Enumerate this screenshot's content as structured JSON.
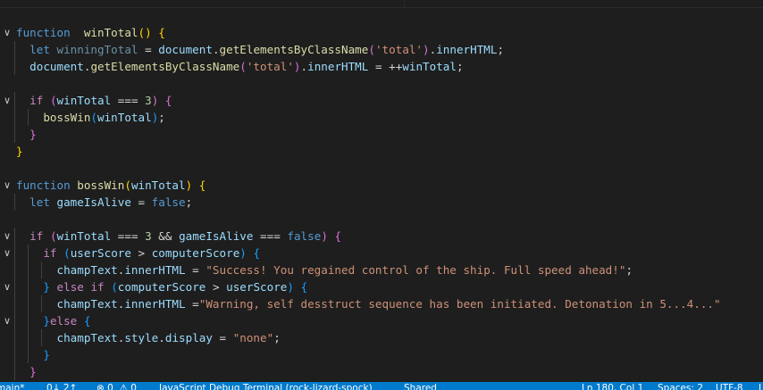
{
  "editor": {
    "lines": [
      {
        "fold": "v",
        "tokens": [
          [
            "kw",
            "function"
          ],
          [
            "",
            "  "
          ],
          [
            "fn",
            "winTotal"
          ],
          [
            "b1",
            "()"
          ],
          [
            "",
            " "
          ],
          [
            "b1",
            "{"
          ]
        ]
      },
      {
        "tokens": [
          [
            "",
            "  "
          ],
          [
            "kw",
            "let"
          ],
          [
            "",
            " "
          ],
          [
            "var unused",
            "winningTotal"
          ],
          [
            "",
            " = "
          ],
          [
            "var",
            "document"
          ],
          [
            "",
            "."
          ],
          [
            "fn",
            "getElementsByClassName"
          ],
          [
            "b2",
            "("
          ],
          [
            "str",
            "'total'"
          ],
          [
            "b2",
            ")"
          ],
          [
            "",
            "."
          ],
          [
            "var",
            "innerHTML"
          ],
          [
            "",
            ";"
          ]
        ]
      },
      {
        "tokens": [
          [
            "",
            "  "
          ],
          [
            "var",
            "document"
          ],
          [
            "",
            "."
          ],
          [
            "fn",
            "getElementsByClassName"
          ],
          [
            "b2",
            "("
          ],
          [
            "str",
            "'total'"
          ],
          [
            "b2",
            ")"
          ],
          [
            "",
            "."
          ],
          [
            "var",
            "innerHTML"
          ],
          [
            "",
            " = ++"
          ],
          [
            "var",
            "winTotal"
          ],
          [
            "",
            ";"
          ]
        ]
      },
      {
        "tokens": []
      },
      {
        "fold": "v",
        "tokens": [
          [
            "",
            "  "
          ],
          [
            "ctl",
            "if"
          ],
          [
            "",
            " "
          ],
          [
            "b2",
            "("
          ],
          [
            "var",
            "winTotal"
          ],
          [
            "",
            " === "
          ],
          [
            "num",
            "3"
          ],
          [
            "b2",
            ")"
          ],
          [
            "",
            " "
          ],
          [
            "b2",
            "{"
          ]
        ]
      },
      {
        "tokens": [
          [
            "",
            "    "
          ],
          [
            "fn",
            "bossWin"
          ],
          [
            "b3",
            "("
          ],
          [
            "var",
            "winTotal"
          ],
          [
            "b3",
            ")"
          ],
          [
            "",
            ";"
          ]
        ]
      },
      {
        "tokens": [
          [
            "",
            "  "
          ],
          [
            "b2",
            "}"
          ]
        ]
      },
      {
        "tokens": [
          [
            "b1",
            "}"
          ]
        ]
      },
      {
        "tokens": []
      },
      {
        "fold": "v",
        "tokens": [
          [
            "kw",
            "function"
          ],
          [
            "",
            " "
          ],
          [
            "fn",
            "bossWin"
          ],
          [
            "b1",
            "("
          ],
          [
            "var",
            "winTotal"
          ],
          [
            "b1",
            ")"
          ],
          [
            "",
            " "
          ],
          [
            "b1",
            "{"
          ]
        ]
      },
      {
        "tokens": [
          [
            "",
            "  "
          ],
          [
            "kw",
            "let"
          ],
          [
            "",
            " "
          ],
          [
            "var",
            "gameIsAlive"
          ],
          [
            "",
            " = "
          ],
          [
            "kw",
            "false"
          ],
          [
            "",
            ";"
          ]
        ]
      },
      {
        "tokens": []
      },
      {
        "fold": "v",
        "tokens": [
          [
            "",
            "  "
          ],
          [
            "ctl",
            "if"
          ],
          [
            "",
            " "
          ],
          [
            "b2",
            "("
          ],
          [
            "var",
            "winTotal"
          ],
          [
            "",
            " === "
          ],
          [
            "num",
            "3"
          ],
          [
            "",
            " && "
          ],
          [
            "var",
            "gameIsAlive"
          ],
          [
            "",
            " === "
          ],
          [
            "kw",
            "false"
          ],
          [
            "b2",
            ")"
          ],
          [
            "",
            " "
          ],
          [
            "b2",
            "{"
          ]
        ]
      },
      {
        "fold": "v",
        "tokens": [
          [
            "",
            "    "
          ],
          [
            "ctl",
            "if"
          ],
          [
            "",
            " "
          ],
          [
            "b3",
            "("
          ],
          [
            "var",
            "userScore"
          ],
          [
            "",
            " > "
          ],
          [
            "var",
            "computerScore"
          ],
          [
            "b3",
            ")"
          ],
          [
            "",
            " "
          ],
          [
            "b3",
            "{"
          ]
        ]
      },
      {
        "tokens": [
          [
            "",
            "      "
          ],
          [
            "var",
            "champText"
          ],
          [
            "",
            "."
          ],
          [
            "var",
            "innerHTML"
          ],
          [
            "",
            " = "
          ],
          [
            "str",
            "\"Success! You regained control of the ship. Full speed ahead!\""
          ],
          [
            "",
            ";"
          ]
        ]
      },
      {
        "fold": "v",
        "tokens": [
          [
            "",
            "    "
          ],
          [
            "b3",
            "}"
          ],
          [
            "",
            " "
          ],
          [
            "ctl",
            "else if"
          ],
          [
            "",
            " "
          ],
          [
            "b3",
            "("
          ],
          [
            "var",
            "computerScore"
          ],
          [
            "",
            " > "
          ],
          [
            "var",
            "userScore"
          ],
          [
            "b3",
            ")"
          ],
          [
            "",
            " "
          ],
          [
            "b3",
            "{"
          ]
        ]
      },
      {
        "tokens": [
          [
            "",
            "      "
          ],
          [
            "var",
            "champText"
          ],
          [
            "",
            "."
          ],
          [
            "var",
            "innerHTML"
          ],
          [
            "",
            " ="
          ],
          [
            "str",
            "\"Warning, self desstruct sequence has been initiated. Detonation in 5...4...\""
          ]
        ]
      },
      {
        "fold": "v",
        "tokens": [
          [
            "",
            "    "
          ],
          [
            "b3",
            "}"
          ],
          [
            "ctl",
            "else"
          ],
          [
            "",
            " "
          ],
          [
            "b3",
            "{"
          ]
        ]
      },
      {
        "tokens": [
          [
            "",
            "      "
          ],
          [
            "var",
            "champText"
          ],
          [
            "",
            "."
          ],
          [
            "var",
            "style"
          ],
          [
            "",
            "."
          ],
          [
            "var",
            "display"
          ],
          [
            "",
            " = "
          ],
          [
            "str",
            "\"none\""
          ],
          [
            "",
            ";"
          ]
        ]
      },
      {
        "tokens": [
          [
            "",
            "    "
          ],
          [
            "b3",
            "}"
          ]
        ]
      },
      {
        "tokens": [
          [
            "",
            "  "
          ],
          [
            "b2",
            "}"
          ]
        ]
      }
    ]
  },
  "status": {
    "branch": "main*",
    "sync": "0↓ 2↑",
    "problems": "⊗ 0  ⚠ 0",
    "debug": "JavaScript Debug Terminal (rock-lizard-spock)",
    "share": "Shared",
    "position": "Ln 180, Col 1",
    "spaces": "Spaces: 2",
    "encoding": "UTF-8",
    "eol": "LF"
  }
}
